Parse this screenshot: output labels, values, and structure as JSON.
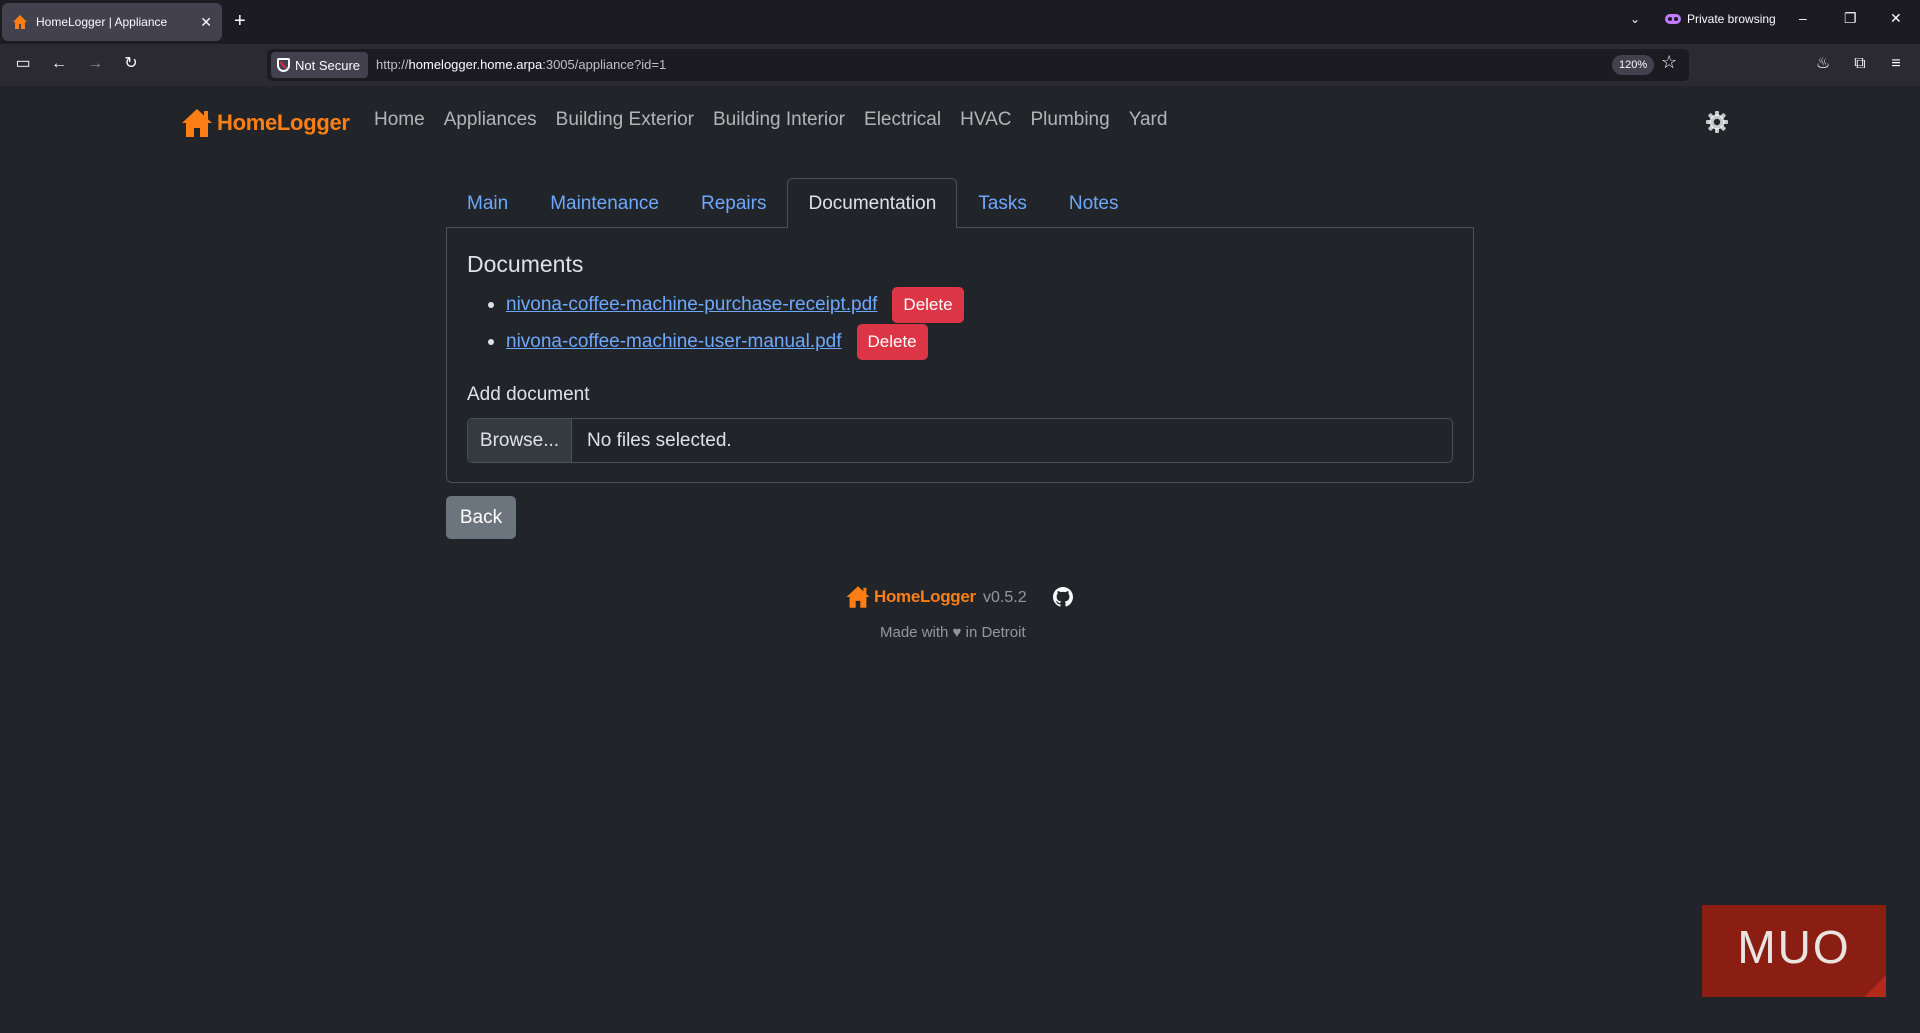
{
  "browser": {
    "tab_title": "HomeLogger | Appliance",
    "new_tab": "+",
    "private_label": "Private browsing",
    "security_label": "Not Secure",
    "url_prefix": "http://",
    "url_host": "homelogger.home.arpa",
    "url_rest": ":3005/appliance?id=1",
    "zoom": "120%"
  },
  "brand": {
    "name": "HomeLogger",
    "color": "#fd7e14"
  },
  "mainnav": {
    "items": [
      "Home",
      "Appliances",
      "Building Exterior",
      "Building Interior",
      "Electrical",
      "HVAC",
      "Plumbing",
      "Yard"
    ]
  },
  "tabs": {
    "items": [
      "Main",
      "Maintenance",
      "Repairs",
      "Documentation",
      "Tasks",
      "Notes"
    ],
    "active": "Documentation"
  },
  "documents": {
    "title": "Documents",
    "files": [
      {
        "name": "nivona-coffee-machine-purchase-receipt.pdf",
        "action": "Delete"
      },
      {
        "name": "nivona-coffee-machine-user-manual.pdf",
        "action": "Delete"
      }
    ],
    "add_label": "Add document",
    "browse_label": "Browse...",
    "no_file_text": "No files selected."
  },
  "back_label": "Back",
  "footer": {
    "version": "v0.5.2",
    "made_with": "Made with ♥ in Detroit"
  },
  "watermark": "MUO"
}
